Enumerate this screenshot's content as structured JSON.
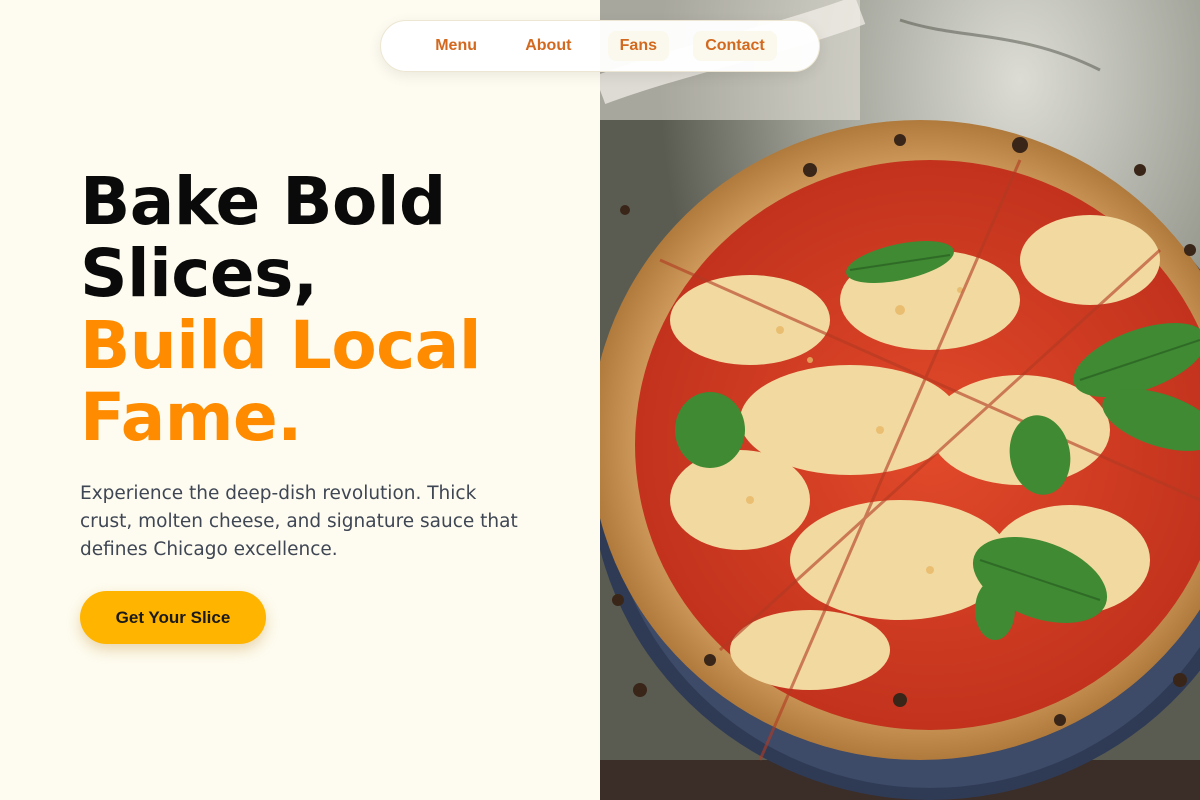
{
  "nav": {
    "items": [
      {
        "label": "Menu"
      },
      {
        "label": "About"
      },
      {
        "label": "Fans"
      },
      {
        "label": "Contact"
      }
    ]
  },
  "hero": {
    "title_line1": "Bake Bold",
    "title_line2": "Slices,",
    "title_line3": "Build Local",
    "title_line4": "Fame.",
    "description": "Experience the deep-dish revolution. Thick crust, molten cheese, and signature sauce that defines Chicago excellence.",
    "cta_label": "Get Your Slice"
  },
  "colors": {
    "background": "#fefcf0",
    "accent": "#ff8c00",
    "nav_link": "#d2691e",
    "cta": "#ffb400",
    "title": "#0a0a0a",
    "body_text": "#3f4654"
  },
  "image": {
    "subject": "pizza-photo"
  }
}
